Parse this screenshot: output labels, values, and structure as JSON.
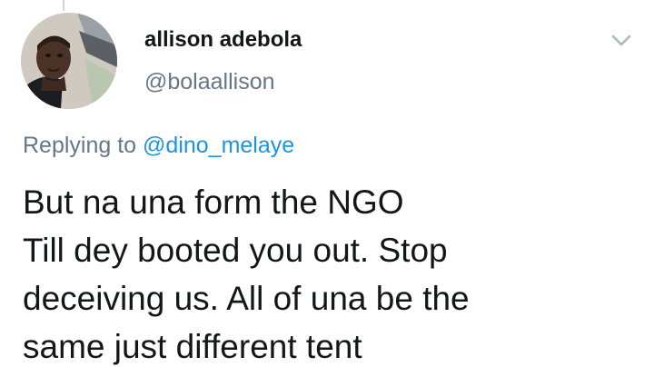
{
  "author": {
    "display_name": "allison adebola",
    "handle": "@bolaallison",
    "avatar_icon": "profile-photo"
  },
  "menu": {
    "icon": "chevron-down-icon"
  },
  "reply": {
    "prefix": "Replying to",
    "mention": "@dino_melaye"
  },
  "tweet": {
    "lines": [
      "But na una form the NGO",
      "Till dey booted you out. Stop",
      "deceiving us. All of una be the",
      "same just different tent"
    ]
  },
  "colors": {
    "text_primary": "#14171a",
    "text_secondary": "#657786",
    "link": "#1b95e0",
    "icon": "#aab8c2"
  }
}
